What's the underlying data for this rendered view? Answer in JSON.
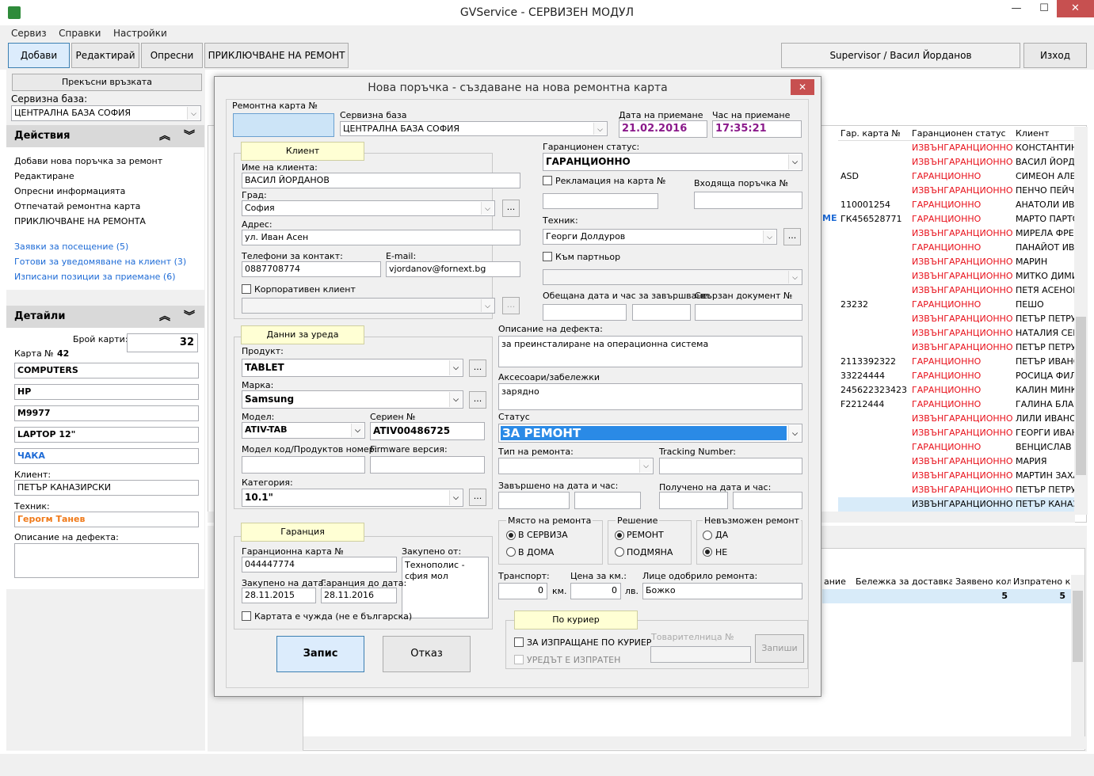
{
  "window": {
    "title": "GVService - СЕРВИЗЕН МОДУЛ",
    "min": "—",
    "max": "☐",
    "close": "✕"
  },
  "menu": [
    "Сервиз",
    "Справки",
    "Настройки"
  ],
  "toolbar": {
    "add": "Добави",
    "edit": "Редактирай",
    "refresh": "Опресни",
    "finish": "ПРИКЛЮЧВАНЕ НА РЕМОНТ",
    "user": "Supervisor / Васил Йорданов",
    "exit": "Изход"
  },
  "left": {
    "disconnect": "Прекъсни връзката",
    "base_label": "Сервизна база:",
    "base_value": "ЦЕНТРАЛНА БАЗА СОФИЯ",
    "actions_title": "Действия",
    "actions": [
      "Добави нова поръчка за ремонт",
      "Редактиране",
      "Опресни информацията",
      "Отпечатай ремонтна карта",
      "ПРИКЛЮЧВАНЕ НА РЕМОНТА"
    ],
    "links": [
      "Заявки за посещение (5)",
      "Готови за уведомяване на клиент (3)",
      "Изписани позиции за приемане (6)"
    ],
    "details_title": "Детайли",
    "count_label": "Брой карти:",
    "count_value": "32",
    "card_label": "Карта №",
    "card_value": "42",
    "product": "COMPUTERS",
    "brand": "HP",
    "model": "M9977",
    "type": "LAPTOP 12\"",
    "status": "ЧАКА",
    "client_label": "Клиент:",
    "client_value": "ПЕТЪР КАНАЗИРСКИ",
    "tech_label": "Техник:",
    "tech_value": "Герогм Танев",
    "defect_label": "Описание на дефекта:"
  },
  "grid": {
    "headers": [
      "Гар. карта №",
      "Гаранционен статус",
      "Клиент"
    ],
    "rows": [
      [
        "",
        "ИЗВЪНГАРАНЦИОННО",
        "КОНСТАНТИН"
      ],
      [
        "",
        "ИЗВЪНГАРАНЦИОННО",
        "ВАСИЛ ЙОРДА"
      ],
      [
        "ASD",
        "ГАРАНЦИОННО",
        "СИМЕОН АЛЕК"
      ],
      [
        "",
        "ИЗВЪНГАРАНЦИОННО",
        "ПЕНЧО ПЕЙЧЕ"
      ],
      [
        "110001254",
        "ГАРАНЦИОННО",
        "АНАТОЛИ ИВА"
      ],
      [
        "ГК456528771",
        "ГАРАНЦИОННО",
        "МАРТО ПАРТО"
      ],
      [
        "",
        "ИЗВЪНГАРАНЦИОННО",
        "МИРЕЛА ФРЕН"
      ],
      [
        "",
        "ГАРАНЦИОННО",
        "ПАНАЙОТ ИВА"
      ],
      [
        "",
        "ИЗВЪНГАРАНЦИОННО",
        "МАРИН"
      ],
      [
        "",
        "ИЗВЪНГАРАНЦИОННО",
        "МИТКО ДИМИ"
      ],
      [
        "",
        "ИЗВЪНГАРАНЦИОННО",
        "ПЕТЯ АСЕНОВ"
      ],
      [
        "23232",
        "ГАРАНЦИОННО",
        "ПЕШО"
      ],
      [
        "",
        "ИЗВЪНГАРАНЦИОННО",
        "ПЕТЪР ПЕТРУН"
      ],
      [
        "",
        "ИЗВЪНГАРАНЦИОННО",
        "НАТАЛИЯ СЕИ"
      ],
      [
        "",
        "ИЗВЪНГАРАНЦИОННО",
        "ПЕТЪР ПЕТРУН"
      ],
      [
        "2113392322",
        "ГАРАНЦИОННО",
        "ПЕТЪР ИВАНО"
      ],
      [
        "33224444",
        "ГАРАНЦИОННО",
        "РОСИЦА ФИЛИ"
      ],
      [
        "245622323423",
        "ГАРАНЦИОННО",
        "КАЛИН МИНКИ"
      ],
      [
        "F2212444",
        "ГАРАНЦИОННО",
        "ГАЛИНА БЛАН"
      ],
      [
        "",
        "ИЗВЪНГАРАНЦИОННО",
        "ЛИЛИ ИВАНОВ"
      ],
      [
        "",
        "ИЗВЪНГАРАНЦИОННО",
        "ГЕОРГИ ИВАНО"
      ],
      [
        "",
        "ГАРАНЦИОННО",
        "ВЕНЦИСЛАВ С"
      ],
      [
        "",
        "ИЗВЪНГАРАНЦИОННО",
        "МАРИЯ"
      ],
      [
        "",
        "ИЗВЪНГАРАНЦИОННО",
        "МАРТИН ЗАХА"
      ],
      [
        "",
        "ИЗВЪНГАРАНЦИОННО",
        "ПЕТЪР ПЕТРУН"
      ],
      [
        "",
        "ИЗВЪНГАРАНЦИОННО",
        "ПЕТЪР КАНАЗ"
      ]
    ],
    "fragment_me": "МЕ",
    "lower_headers": [
      "ание",
      "Бележка за доставка",
      "Заявено кол.",
      "Изпратено кол."
    ],
    "lower_row": [
      "",
      "",
      "5",
      "5"
    ]
  },
  "dialog": {
    "title": "Нова поръчка - създаване на нова ремонтна карта",
    "card_no_label": "Ремонтна карта №",
    "base_label": "Сервизна база",
    "base_value": "ЦЕНТРАЛНА БАЗА СОФИЯ",
    "date_label": "Дата на приемане",
    "date_value": "21.02.2016",
    "time_label": "Час на приемане",
    "time_value": "17:35:21",
    "client_tab": "Клиент",
    "client_name_label": "Име на клиента:",
    "client_name": "ВАСИЛ ЙОРДАНОВ",
    "city_label": "Град:",
    "city": "София",
    "address_label": "Адрес:",
    "address": "ул. Иван Асен",
    "phones_label": "Телефони за контакт:",
    "phone": "0887708774",
    "email_label": "E-mail:",
    "email": "vjordanov@fornext.bg",
    "corporate_label": "Корпоративен клиент",
    "warranty_status_label": "Гаранционен статус:",
    "warranty_status": "ГАРАНЦИОННО",
    "reclamation_label": "Рекламация на карта №",
    "incoming_order_label": "Входяща поръчка №",
    "technician_label": "Техник:",
    "technician": "Георги Долдуров",
    "partner_label": "Към партньор",
    "promised_label": "Обещана дата и час за завършване:",
    "linked_doc_label": "Свързан документ №",
    "device_tab": "Данни за уреда",
    "product_label": "Продукт:",
    "product": "TABLET",
    "brand_label": "Марка:",
    "brand": "Samsung",
    "model_label": "Модел:",
    "model": "ATIV-TAB",
    "serial_label": "Сериен №",
    "serial": "ATIV00486725",
    "model_code_label": "Модел код/Продуктов номер:",
    "firmware_label": "Firmware версия:",
    "category_label": "Категория:",
    "category": "10.1\"",
    "defect_label": "Описание на дефекта:",
    "defect": "за преинсталиране на операционна система",
    "accessories_label": "Аксесоари/забележки",
    "accessories": "зарядно",
    "status_label": "Статус",
    "status": "ЗА РЕМОНТ",
    "repair_type_label": "Тип на ремонта:",
    "tracking_label": "Tracking Number:",
    "completed_label": "Завършено на дата и час:",
    "received_label": "Получено на дата и час:",
    "location_label": "Място на ремонта",
    "loc_service": "В СЕРВИЗА",
    "loc_home": "В ДОМА",
    "decision_label": "Решение",
    "dec_repair": "РЕМОНТ",
    "dec_replace": "ПОДМЯНА",
    "impossible_label": "Невъзможен ремонт",
    "imp_yes": "ДА",
    "imp_no": "НЕ",
    "transport_label": "Транспорт:",
    "transport": "0",
    "km": "км.",
    "price_label": "Цена за км.:",
    "price": "0",
    "lv": "лв.",
    "approver_label": "Лице одобрило ремонта:",
    "approver": "Божко",
    "warranty_tab": "Гаранция",
    "warranty_card_label": "Гаранционна карта №",
    "warranty_card": "044447774",
    "bought_from_label": "Закупено от:",
    "bought_from": "Технополис - сфия мол",
    "bought_date_label": "Закупено на дата:",
    "bought_date": "28.11.2015",
    "warranty_until_label": "Гаранция до дата:",
    "warranty_until": "28.11.2016",
    "foreign_label": "Картата е чужда (не е българска)",
    "courier_tab": "По куриер",
    "courier_send_label": "ЗА ИЗПРАЩАНЕ ПО КУРИЕР",
    "courier_sent_label": "УРЕДЪТ Е ИЗПРАТЕН",
    "waybill_label": "Товарителница №",
    "save_small": "Запиши",
    "save": "Запис",
    "cancel": "Отказ"
  },
  "colors": {
    "accent": "#3c7fb1",
    "red": "#e8101a",
    "link": "#1e6bd6",
    "orange": "#f07a1a",
    "status_bg": "#2a8ae6",
    "date": "#8b1a8b"
  }
}
